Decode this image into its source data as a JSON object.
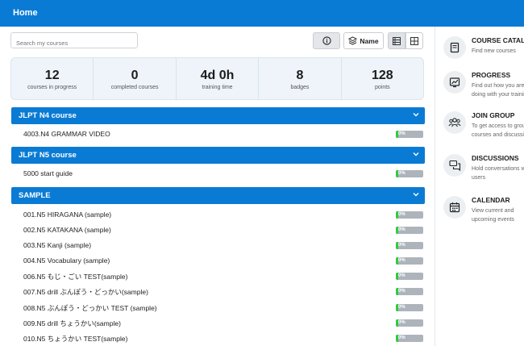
{
  "header": {
    "title": "Home"
  },
  "search": {
    "placeholder": "Search my courses"
  },
  "toolbar": {
    "sort_label": "Name"
  },
  "stats": [
    {
      "value": "12",
      "label": "courses in progress"
    },
    {
      "value": "0",
      "label": "completed courses"
    },
    {
      "value": "4d 0h",
      "label": "training time"
    },
    {
      "value": "8",
      "label": "badges"
    },
    {
      "value": "128",
      "label": "points"
    }
  ],
  "sections": [
    {
      "title": "JLPT N4 course",
      "courses": [
        {
          "name": "4003.N4 GRAMMAR VIDEO",
          "progress": "0%"
        }
      ]
    },
    {
      "title": "JLPT N5 course",
      "courses": [
        {
          "name": "5000 start guide",
          "progress": "0%"
        }
      ]
    },
    {
      "title": "SAMPLE",
      "courses": [
        {
          "name": "001.N5 HIRAGANA (sample)",
          "progress": "0%"
        },
        {
          "name": "002.N5 KATAKANA (sample)",
          "progress": "0%"
        },
        {
          "name": "003.N5 Kanji (sample)",
          "progress": "0%"
        },
        {
          "name": "004.N5 Vocabulary (sample)",
          "progress": "0%"
        },
        {
          "name": "006.N5 もじ・ごい TEST(sample)",
          "progress": "0%"
        },
        {
          "name": "007.N5 drill ぶんぽう・どっかい(sample)",
          "progress": "0%"
        },
        {
          "name": "008.N5 ぶんぽう・どっかい TEST (sample)",
          "progress": "0%"
        },
        {
          "name": "009.N5 drill ちょうかい(sample)",
          "progress": "0%"
        },
        {
          "name": "010.N5 ちょうかい TEST(sample)",
          "progress": "0%"
        }
      ]
    }
  ],
  "sidebar": {
    "items": [
      {
        "title": "COURSE CATALOG",
        "desc": "Find new courses",
        "icon": "book-icon"
      },
      {
        "title": "PROGRESS",
        "desc": "Find out how you are doing with your training",
        "icon": "progress-chart-icon"
      },
      {
        "title": "JOIN GROUP",
        "desc": "To get access to group courses and discussions",
        "icon": "group-icon"
      },
      {
        "title": "DISCUSSIONS",
        "desc": "Hold conversations with users",
        "icon": "chat-icon"
      },
      {
        "title": "CALENDAR",
        "desc": "View current and upcoming events",
        "icon": "calendar-icon"
      }
    ]
  },
  "colors": {
    "header": "#0a7bd4",
    "section": "#0a7bd4",
    "progress_fill": "#2ecc40",
    "progress_track": "#adb4bb"
  }
}
